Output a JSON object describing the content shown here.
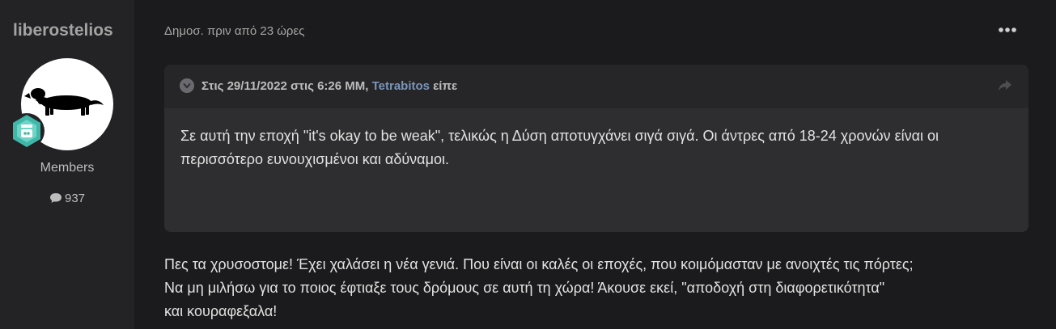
{
  "author": {
    "username": "liberostelios",
    "group": "Members",
    "post_count": "937",
    "icons": {
      "avatar": "dachshund-silhouette",
      "badge": "rank-badge-icon",
      "post_count": "speech-bubble-icon"
    },
    "badge_color": "#3fb8a9"
  },
  "post": {
    "date": "Δημοσ. πριν από 23 ώρες",
    "menu_icon": "ellipsis-icon",
    "quote": {
      "citation_prefix": "Στις 29/11/2022 στις 6:26 ΜΜ, ",
      "author": "Tetrabitos",
      "citation_suffix": " είπε",
      "text": "Σε αυτή την εποχή \"it's okay to be weak\", τελικώς η Δύση αποτυγχάνει σιγά σιγά. Οι άντρες από 18-24 χρονών είναι οι περισσότερο ευνουχισμένοι και αδύναμοι.",
      "toggle_icon": "chevron-down-icon",
      "share_icon": "share-arrow-icon"
    },
    "body_lines": [
      "Πες τα χρυσοστομε! Έχει χαλάσει η νέα γενιά. Που είναι οι καλές οι εποχές, που κοιμόμασταν με ανοιχτές τις πόρτες;",
      "Να μη μιλήσω για το ποιος έφτιαξε τους δρόμους σε αυτή τη χώρα! Άκουσε εκεί, \"αποδοχή στη διαφορετικότητα\"",
      "και κουραφεξαλα!"
    ]
  },
  "colors": {
    "background": "#1b1b1d",
    "sidebar": "#232326",
    "quote_background": "#2e2e31",
    "link": "#7a95b8"
  }
}
